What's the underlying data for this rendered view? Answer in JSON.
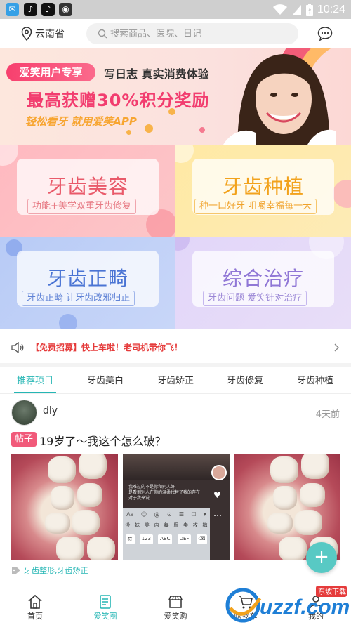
{
  "status_bar": {
    "time": "10:24"
  },
  "header": {
    "location": "云南省",
    "search_placeholder": "搜索商品、医院、日记"
  },
  "banner": {
    "pill": "爱笑用户专享",
    "subtitle": "写日志 真实消费体验",
    "headline": "最高获赠30%积分奖励",
    "tagline": "轻松看牙 就用爱笑APP"
  },
  "categories": [
    {
      "title": "牙齿美容",
      "tag": "功能+美学双重牙齿修复"
    },
    {
      "title": "牙齿种植",
      "tag": "种一口好牙 咀嚼幸福每一天"
    },
    {
      "title": "牙齿正畸",
      "tag": "牙齿正畸 让牙齿改邪归正"
    },
    {
      "title": "综合治疗",
      "tag": "牙齿问题 爱笑针对治疗"
    }
  ],
  "notice": {
    "text": "【免费招募】快上车啦！老司机带你飞！"
  },
  "tabs": [
    "推荐项目",
    "牙齿美白",
    "牙齿矫正",
    "牙齿修复",
    "牙齿种植"
  ],
  "post": {
    "username": "dly",
    "time": "4天前",
    "badge": "帖子",
    "title": "19岁了～我这个怎么破？",
    "tags": "牙齿整形,牙齿矫正",
    "screenshot_text": {
      "line1": "我难过的不是你和别人好",
      "line2": "是看到别人在你的温柔代替了我的存在",
      "line3": "对于我来说",
      "keys_row1": [
        "Aa",
        "☺",
        "@",
        "⊙",
        "☰",
        "☐",
        "▾"
      ],
      "keys_row2": [
        "没",
        "妹",
        "美",
        "内",
        "每",
        "眉",
        "卖",
        "枚",
        "梅"
      ],
      "keys_row3": [
        "符",
        "123",
        "ABC",
        "DEF",
        "⌫"
      ]
    }
  },
  "bottom_nav": [
    "首页",
    "爱笑圈",
    "爱笑购",
    "购物车",
    "我的"
  ],
  "watermark": "uzzf.com",
  "watermark_top": "东坡下载",
  "colors": {
    "accent": "#25b6b4",
    "pink": "#f15a7a",
    "notice": "#e53b3b"
  }
}
